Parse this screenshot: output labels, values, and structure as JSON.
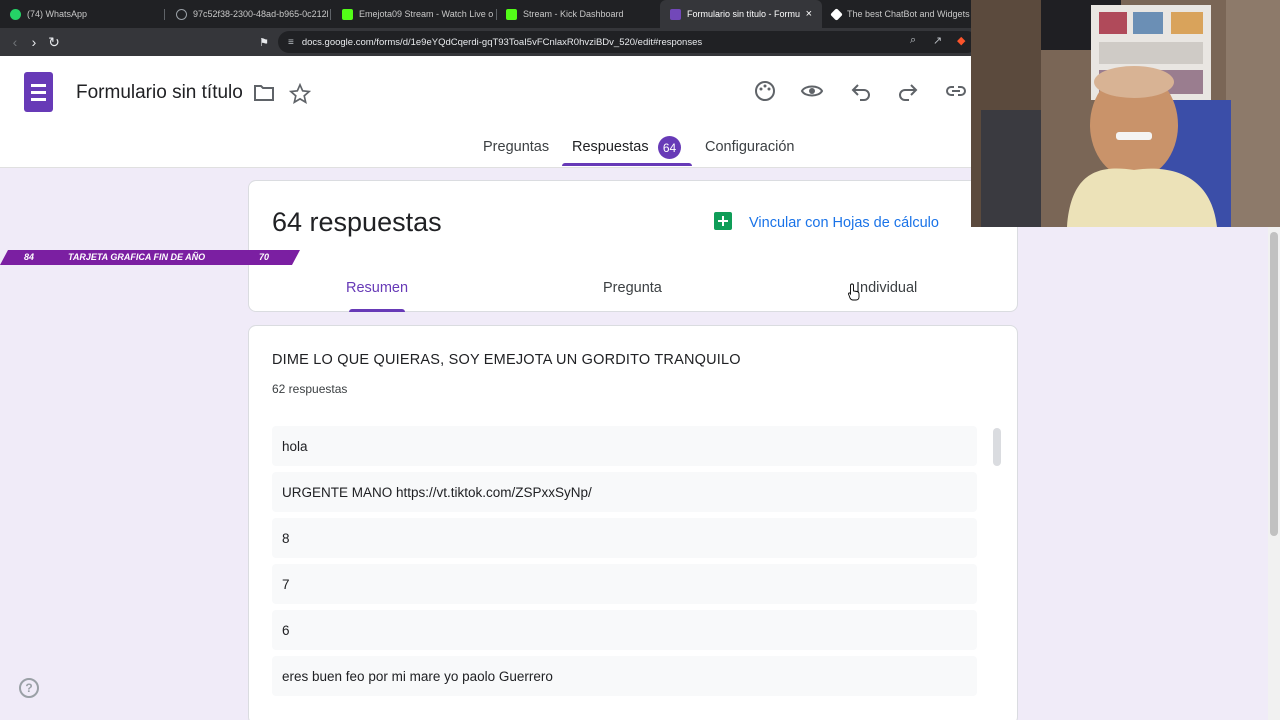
{
  "browser": {
    "tabs": [
      {
        "title": "(74) WhatsApp",
        "favicon_color": "#25d366",
        "favicon": "whatsapp-icon"
      },
      {
        "title": "97c52f38-2300-48ad-b965-0c212b6",
        "favicon_color": "#9aa0a6",
        "favicon": "globe-icon"
      },
      {
        "title": "Emejota09 Stream - Watch Live o",
        "favicon_color": "#53fc18",
        "favicon": "kick-icon"
      },
      {
        "title": "Stream - Kick Dashboard",
        "favicon_color": "#53fc18",
        "favicon": "kick-icon"
      },
      {
        "title": "Formulario sin título - Formulari",
        "favicon_color": "#7248b9",
        "favicon": "forms-icon"
      },
      {
        "title": "The best ChatBot and Widgets for",
        "favicon_color": "#ffffff",
        "favicon": "bot-icon"
      }
    ],
    "active_tab_close": "×",
    "url": "docs.google.com/forms/d/1e9eYQdCqerdi-gqT93ToaI5vFCnlaxR0hvziBDv_520/edit#responses"
  },
  "form": {
    "title": "Formulario sin título",
    "tabs": {
      "preguntas": "Preguntas",
      "respuestas": "Respuestas",
      "configuracion": "Configuración"
    },
    "response_badge": "64"
  },
  "summary": {
    "count_label": "64 respuestas",
    "link_sheets": "Vincular con Hojas de cálculo",
    "tabs": {
      "resumen": "Resumen",
      "pregunta": "Pregunta",
      "individual": "Individual"
    }
  },
  "question": {
    "title": "DIME LO QUE QUIERAS, SOY EMEJOTA UN GORDITO TRANQUILO",
    "response_count": "62 respuestas",
    "answers": [
      "hola",
      "URGENTE MANO https://vt.tiktok.com/ZSPxxSyNp/",
      "8",
      "7",
      "6",
      "eres buen feo por mi mare yo paolo Guerrero"
    ]
  },
  "overlay_banner": {
    "left": "84",
    "text": "TARJETA GRAFICA FIN DE AÑO",
    "right": "70"
  },
  "colors": {
    "accent": "#673ab7",
    "page_bg": "#f0ebf8",
    "link": "#1a73e8",
    "sheets_green": "#0f9d58"
  }
}
